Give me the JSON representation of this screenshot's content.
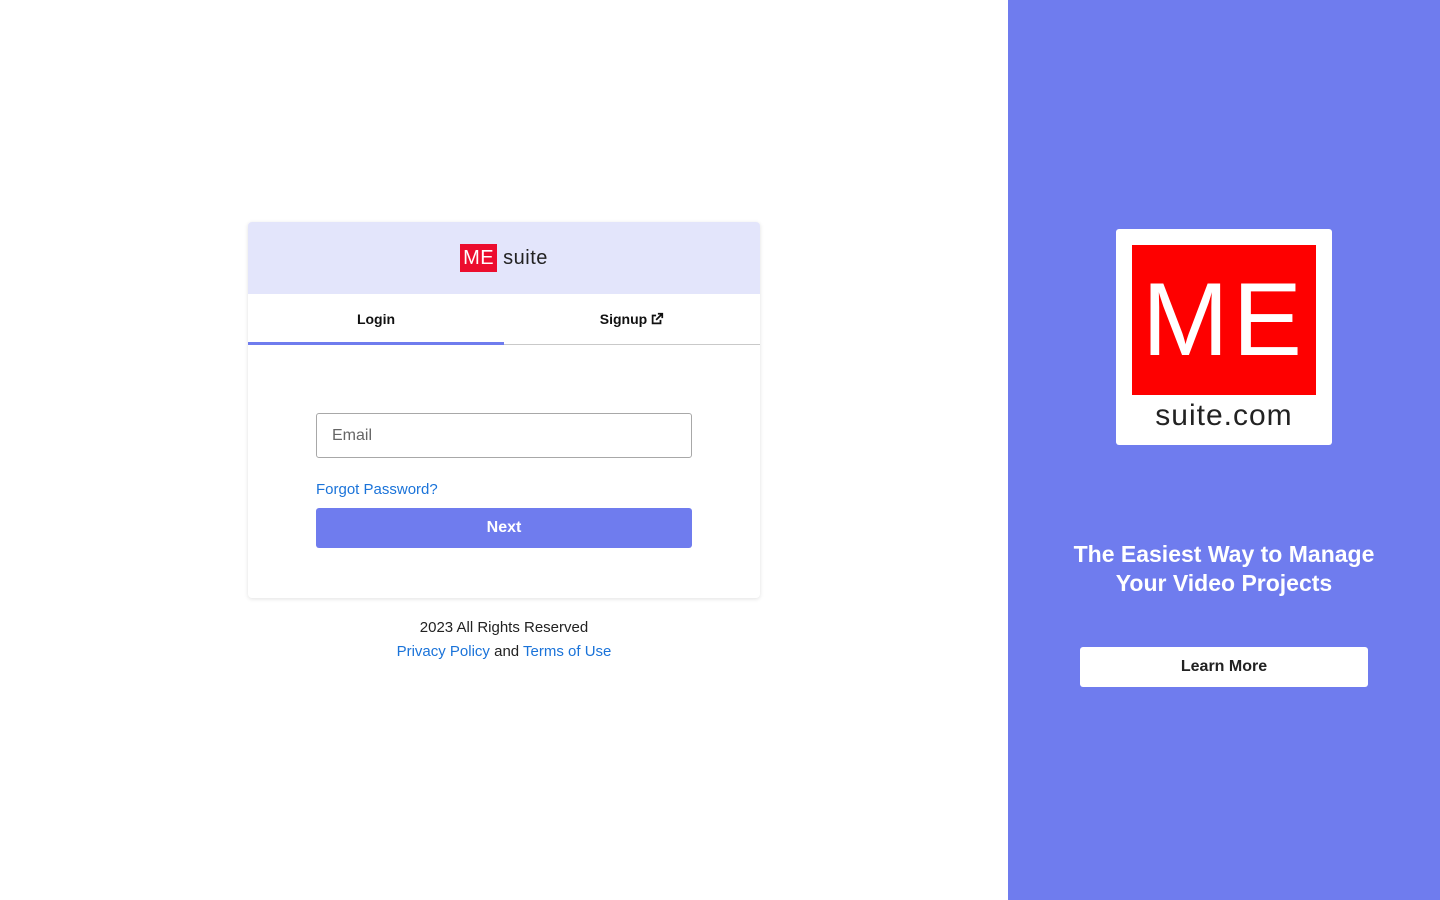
{
  "brand": {
    "box_text": "ME",
    "suffix_text": "suite"
  },
  "tabs": [
    {
      "label": "Login",
      "active": true
    },
    {
      "label": "Signup",
      "active": false,
      "icon": "external-link-icon"
    }
  ],
  "form": {
    "email_placeholder": "Email",
    "email_value": "",
    "forgot_label": "Forgot Password?",
    "next_label": "Next"
  },
  "footer": {
    "rights": "2023 All Rights Reserved",
    "privacy_label": "Privacy Policy",
    "and_text": "and",
    "terms_label": "Terms of Use"
  },
  "promo": {
    "logo_text": "ME",
    "logo_domain": "suite.com",
    "tagline": "The Easiest Way to Manage Your Video Projects",
    "cta_label": "Learn More"
  },
  "colors": {
    "accent": "#6f7cee",
    "brand_red": "#ec0d2e",
    "link": "#1a73d9",
    "header_bg": "#e3e5fb"
  }
}
